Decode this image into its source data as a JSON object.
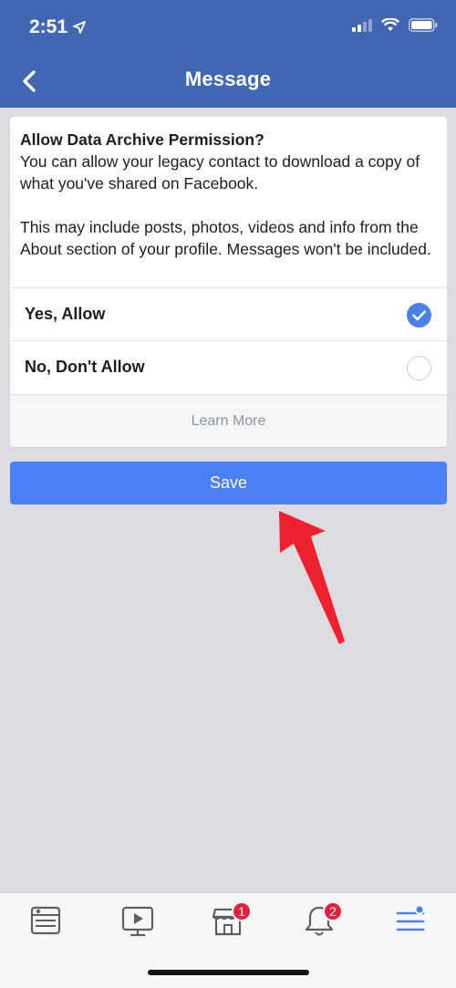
{
  "status_bar": {
    "time": "2:51",
    "icons": [
      "location-arrow-icon",
      "signal-icon",
      "wifi-icon",
      "battery-icon"
    ]
  },
  "header": {
    "title": "Message",
    "back_icon": "chevron-left-icon"
  },
  "dialog": {
    "heading": "Allow Data Archive Permission?",
    "body_1": "You can allow your legacy contact to download a copy of what you've shared on Facebook.",
    "body_2": "This may include posts, photos, videos and info from the About section of your profile. Messages won't be included.",
    "options": [
      {
        "label": "Yes, Allow",
        "selected": true
      },
      {
        "label": "No, Don't Allow",
        "selected": false
      }
    ],
    "learn_more": "Learn More"
  },
  "save_label": "Save",
  "tab_bar": {
    "tabs": [
      {
        "icon": "news-feed-icon"
      },
      {
        "icon": "watch-icon"
      },
      {
        "icon": "marketplace-icon",
        "badge": "1"
      },
      {
        "icon": "notifications-bell-icon",
        "badge": "2"
      },
      {
        "icon": "menu-icon",
        "active": true
      }
    ]
  },
  "colors": {
    "header_bg": "#4267b2",
    "primary_button": "#4a80f6",
    "selected_radio": "#4a80e8",
    "badge": "#e41e3f",
    "annotation_arrow": "#f0212e"
  }
}
